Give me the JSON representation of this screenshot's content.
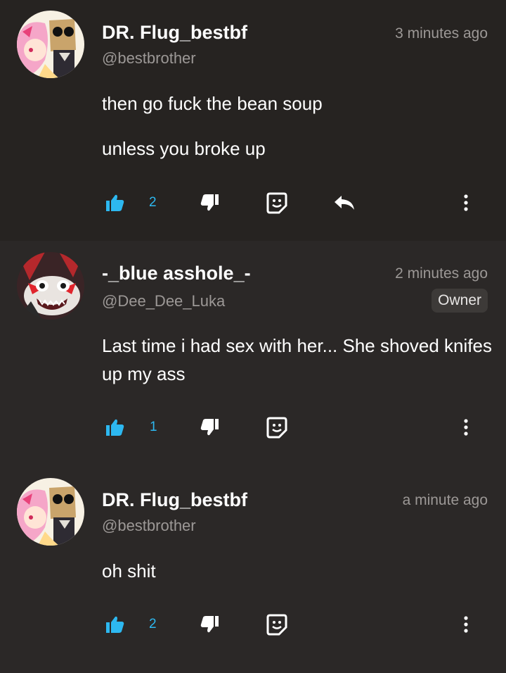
{
  "comments": [
    {
      "author": "DR. Flug_bestbf",
      "handle": "@bestbrother",
      "time": "3 minutes ago",
      "paragraphs": [
        "then go fuck the bean soup",
        "unless you broke up"
      ],
      "likes": "2",
      "avatar": "anime-girl-and-paper-bag-avatar",
      "has_reply": true
    },
    {
      "author": "-_blue asshole_-",
      "handle": "@Dee_Dee_Luka",
      "time": "2 minutes ago",
      "badge": "Owner",
      "paragraphs": [
        "Last time i had sex with her... She shoved knifes up my ass"
      ],
      "likes": "1",
      "avatar": "demon-cartoon-avatar",
      "has_reply": false
    },
    {
      "author": "DR. Flug_bestbf",
      "handle": "@bestbrother",
      "time": "a minute ago",
      "paragraphs": [
        "oh shit"
      ],
      "likes": "2",
      "avatar": "anime-girl-and-paper-bag-avatar",
      "has_reply": false
    }
  ],
  "icons": {
    "like": "thumbs-up-icon",
    "dislike": "thumbs-down-icon",
    "sticker": "sticker-icon",
    "reply": "reply-icon",
    "more": "more-vertical-icon"
  },
  "colors": {
    "accent": "#2db8f0",
    "muted": "#9c9896",
    "background": "#2b2827",
    "highlight_background": "#262321"
  }
}
